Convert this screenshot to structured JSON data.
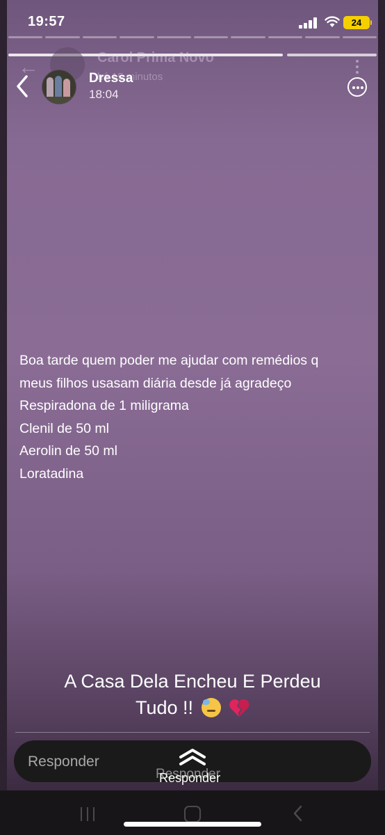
{
  "status_bar": {
    "time": "19:57",
    "battery": "24"
  },
  "ghost_header": {
    "name": "Carol Prima Novo",
    "subtitle": "há 15 minutos"
  },
  "header": {
    "name": "Dressa",
    "time": "18:04"
  },
  "story": {
    "lines": [
      "Boa tarde quem poder me ajudar com remédios q",
      "meus filhos usasam diária desde já agradeço",
      "Respiradona de 1 miligrama",
      "Clenil de 50 ml",
      "Aerolin de 50 ml",
      "Loratadina"
    ],
    "caption_line1": "A Casa Dela Encheu E Perdeu",
    "caption_line2": "Tudo !!"
  },
  "reply": {
    "placeholder": "Responder",
    "ghost_label": "Responder",
    "swipe_label": "Responder"
  },
  "icons": {
    "back": "chevron-left-icon",
    "more": "more-horizontal-icon",
    "swipe": "chevron-up-icon",
    "emoji1": "downcast-sweat-emoji",
    "emoji2": "broken-heart-emoji"
  },
  "colors": {
    "background": "#8a6c95",
    "battery": "#f5d000",
    "reply_bar": "#1a1a1a"
  }
}
